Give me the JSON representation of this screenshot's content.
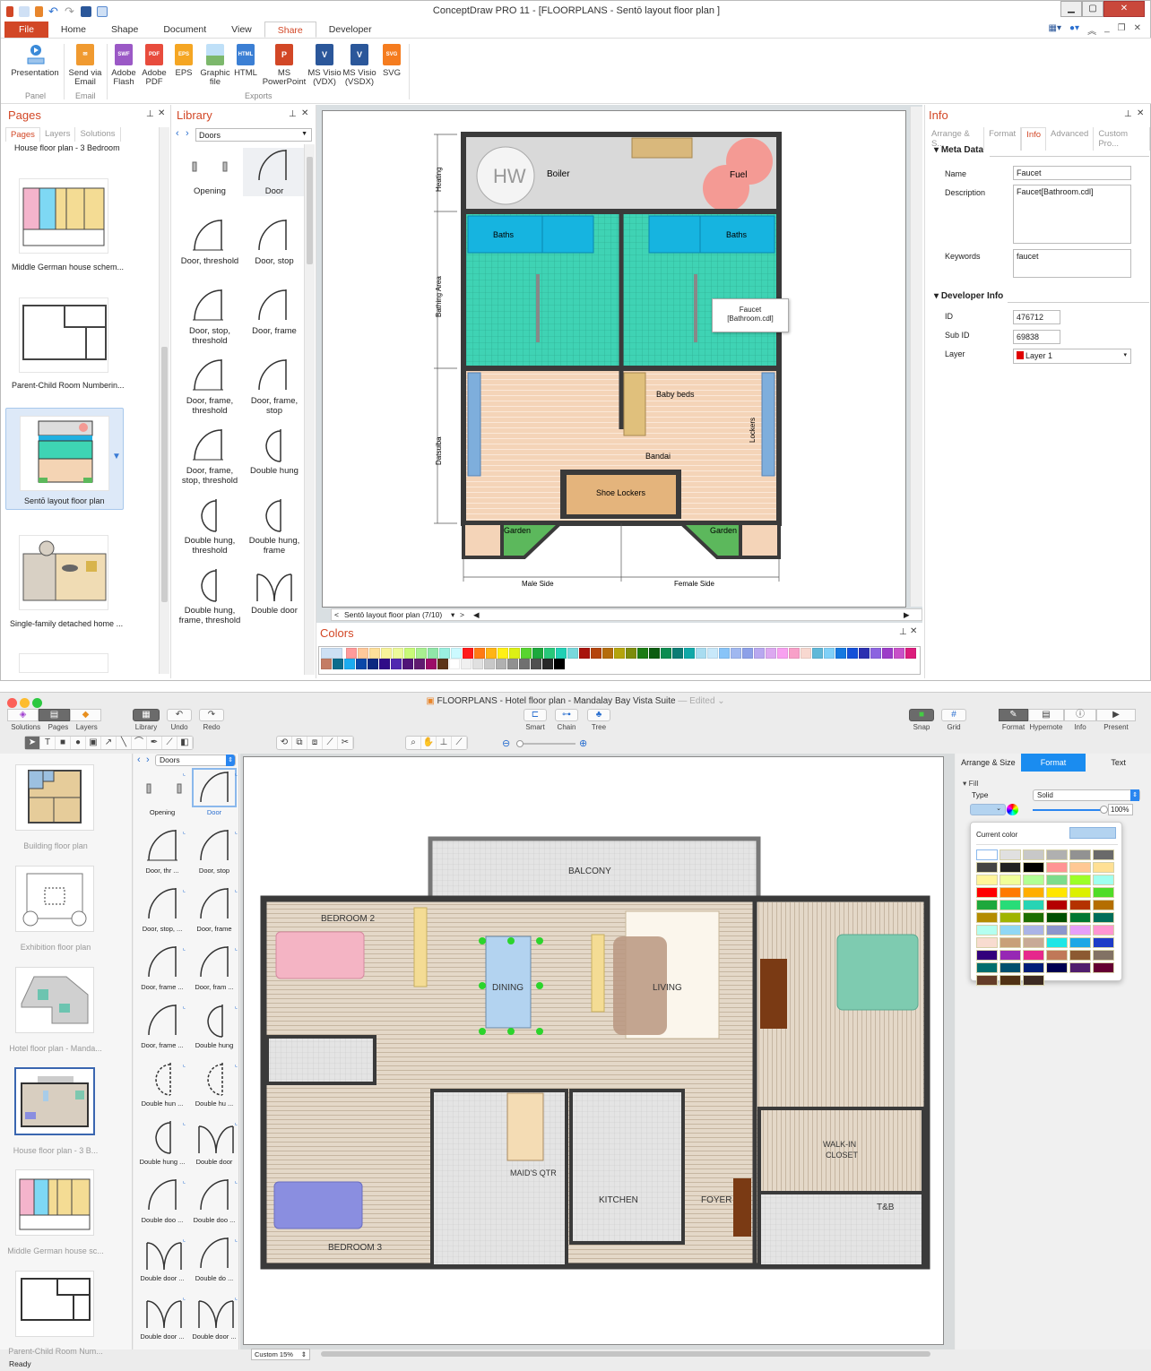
{
  "win": {
    "title": "ConceptDraw PRO 11 - [FLOORPLANS - Sentō layout floor plan ]",
    "ribbon_tabs": [
      {
        "label": "File"
      },
      {
        "label": "Home"
      },
      {
        "label": "Shape"
      },
      {
        "label": "Document"
      },
      {
        "label": "View"
      },
      {
        "label": "Share"
      },
      {
        "label": "Developer"
      }
    ],
    "active_tab": "Share",
    "ribbon_buttons": [
      {
        "label": "Presentation",
        "group": "Panel",
        "icon": "presentation-icon"
      },
      {
        "label": "Send via Email",
        "group": "Email",
        "icon": "email-icon"
      },
      {
        "label": "Adobe Flash",
        "group": "Exports",
        "icon": "swf-file-icon",
        "badge": "SWF",
        "color": "#9b59c6"
      },
      {
        "label": "Adobe PDF",
        "group": "Exports",
        "icon": "pdf-file-icon",
        "badge": "PDF",
        "color": "#e84c3d"
      },
      {
        "label": "EPS",
        "group": "Exports",
        "icon": "eps-file-icon",
        "badge": "EPS",
        "color": "#f5a623"
      },
      {
        "label": "Graphic file",
        "group": "Exports",
        "icon": "image-file-icon",
        "badge": "",
        "color": "#7fb9e6"
      },
      {
        "label": "HTML",
        "group": "Exports",
        "icon": "html-file-icon",
        "badge": "HTML",
        "color": "#3b7fd4"
      },
      {
        "label": "MS PowerPoint",
        "group": "Exports",
        "icon": "powerpoint-icon",
        "badge": "P",
        "color": "#d24726"
      },
      {
        "label": "MS Visio (VDX)",
        "group": "Exports",
        "icon": "visio-vdx-icon",
        "badge": "V",
        "color": "#2b579a"
      },
      {
        "label": "MS Visio (VSDX)",
        "group": "Exports",
        "icon": "visio-vsdx-icon",
        "badge": "V",
        "color": "#2b579a"
      },
      {
        "label": "SVG",
        "group": "Exports",
        "icon": "svg-file-icon",
        "badge": "SVG",
        "color": "#f57c1f"
      }
    ],
    "ribbon_groups": {
      "panel": "Panel",
      "email": "Email",
      "exports": "Exports"
    },
    "pages_panel": {
      "title": "Pages",
      "tabs": [
        "Pages",
        "Layers",
        "Solutions"
      ],
      "items": [
        {
          "label": "House floor plan - 3 Bedroom"
        },
        {
          "label": "Middle German house schem..."
        },
        {
          "label": "Parent-Child Room Numberin..."
        },
        {
          "label": "Sentō layout floor plan",
          "selected": true
        },
        {
          "label": "Single-family detached home ..."
        }
      ]
    },
    "library_panel": {
      "title": "Library",
      "selected_library": "Doors",
      "items": [
        {
          "label": "Opening"
        },
        {
          "label": "Door"
        },
        {
          "label": "Door, threshold"
        },
        {
          "label": "Door, stop"
        },
        {
          "label": "Door, stop, threshold"
        },
        {
          "label": "Door, frame"
        },
        {
          "label": "Door, frame, threshold"
        },
        {
          "label": "Door, frame, stop"
        },
        {
          "label": "Door, frame, stop, threshold"
        },
        {
          "label": "Double hung"
        },
        {
          "label": "Double hung, threshold"
        },
        {
          "label": "Double hung, frame"
        },
        {
          "label": "Double hung, frame, threshold"
        },
        {
          "label": "Double door"
        }
      ]
    },
    "canvas": {
      "page_nav": "Sentō layout floor plan  (7/10)",
      "plan_labels": {
        "boiler": "Boiler",
        "hw": "HW",
        "fuel": "Fuel",
        "baths_left": "Baths",
        "baths_right": "Baths",
        "baby_beds": "Baby beds",
        "bandai": "Bandai",
        "lockers": "Lockers",
        "shoe_lockers": "Shoe Lockers",
        "garden_left": "Garden",
        "garden_right": "Garden",
        "male_side": "Male Side",
        "female_side": "Female Side",
        "heating": "Heating",
        "bathing_area": "Bathing Area",
        "datsuiba": "Datsuiba"
      },
      "tooltip": {
        "line1": "Faucet",
        "line2": "[Bathroom.cdl]"
      }
    },
    "colors_panel": {
      "title": "Colors",
      "swatches": [
        "#ff9a9a",
        "#ffc89a",
        "#ffe09a",
        "#f8f49a",
        "#ecfa9a",
        "#c8fa78",
        "#a8f090",
        "#90e6a8",
        "#9af0e0",
        "#ccfaff",
        "#ff1a1a",
        "#ff7a14",
        "#ffb414",
        "#fff014",
        "#dcf014",
        "#58d430",
        "#1ca83c",
        "#28c87a",
        "#20d0b4",
        "#78d8dc",
        "#a8140c",
        "#b4440c",
        "#b46c0c",
        "#b4a40c",
        "#7c8c0c",
        "#1c7c14",
        "#0c5c10",
        "#0c8c50",
        "#0c7c74",
        "#10a8a8",
        "#a8dcf0",
        "#c8e8fa",
        "#88c4f8",
        "#a0b8f0",
        "#8ca0e8",
        "#b8a8f0",
        "#dca8f0",
        "#f8a0f0",
        "#f8a0c8",
        "#f8d8d0",
        "#60b8d8",
        "#80d0f8",
        "#1478e0",
        "#1450d8",
        "#2c30b0",
        "#8c64e0",
        "#9c3cc8",
        "#c850c8",
        "#dc1c7c",
        "#c47c64",
        "#0c6c8c",
        "#1cacf0",
        "#0c48a8",
        "#0c2880",
        "#300c88",
        "#5028b0",
        "#501478",
        "#601c70",
        "#9c0c68",
        "#5c3418",
        "#ffffff",
        "#f0f0f0",
        "#e0e0e0",
        "#c8c8c8",
        "#b0b0b0",
        "#909090",
        "#707070",
        "#505050",
        "#282828",
        "#000000"
      ]
    },
    "info_panel": {
      "title": "Info",
      "tabs": [
        "Arrange & S...",
        "Format",
        "Info",
        "Advanced",
        "Custom Pro..."
      ],
      "active_tab": "Info",
      "meta_section": "Meta Data",
      "name_label": "Name",
      "name_value": "Faucet",
      "description_label": "Description",
      "description_value": "Faucet[Bathroom.cdl]",
      "keywords_label": "Keywords",
      "keywords_value": "faucet",
      "dev_section": "Developer Info",
      "id_label": "ID",
      "id_value": "476712",
      "subid_label": "Sub ID",
      "subid_value": "69838",
      "layer_label": "Layer",
      "layer_value": "Layer 1",
      "layer_color": "#e00000"
    }
  },
  "mac": {
    "title": "FLOORPLANS - Hotel floor plan - Mandalay Bay Vista Suite",
    "edited": "— Edited ⌄",
    "toolbar": {
      "solutions": "Solutions",
      "pages": "Pages",
      "layers": "Layers",
      "library": "Library",
      "undo": "Undo",
      "redo": "Redo",
      "smart": "Smart",
      "chain": "Chain",
      "tree": "Tree",
      "snap": "Snap",
      "grid": "Grid",
      "format": "Format",
      "hypernote": "Hypernote",
      "info": "Info",
      "present": "Present"
    },
    "pages": [
      {
        "label": "Building floor plan"
      },
      {
        "label": "Exhibition floor plan"
      },
      {
        "label": "Hotel floor plan - Manda..."
      },
      {
        "label": "House floor plan - 3 B...",
        "selected": true
      },
      {
        "label": "Middle German house sc..."
      },
      {
        "label": "Parent-Child Room Num..."
      }
    ],
    "library": {
      "selected_library": "Doors",
      "items": [
        {
          "label": "Opening"
        },
        {
          "label": "Door",
          "selected": true
        },
        {
          "label": "Door, thr ..."
        },
        {
          "label": "Door, stop"
        },
        {
          "label": "Door, stop, ..."
        },
        {
          "label": "Door, frame"
        },
        {
          "label": "Door, frame ..."
        },
        {
          "label": "Door, fram ..."
        },
        {
          "label": "Door, frame ..."
        },
        {
          "label": "Double hung"
        },
        {
          "label": "Double hun ..."
        },
        {
          "label": "Double hu ..."
        },
        {
          "label": "Double hung ..."
        },
        {
          "label": "Double door"
        },
        {
          "label": "Double doo ..."
        },
        {
          "label": "Double doo ..."
        },
        {
          "label": "Double door ..."
        },
        {
          "label": "Double do ..."
        },
        {
          "label": "Double door ..."
        },
        {
          "label": "Double door ..."
        }
      ]
    },
    "canvas": {
      "zoom": "Custom 15%",
      "rooms": {
        "balcony": "BALCONY",
        "bedroom2": "BEDROOM 2",
        "dining": "DINING",
        "living": "LIVING",
        "walkin": "WALK-IN",
        "closet": "CLOSET",
        "maids": "MAID'S QTR",
        "kitchen": "KITCHEN",
        "foyer": "FOYER",
        "tb": "T&B",
        "bedroom3": "BEDROOM 3"
      }
    },
    "inspector": {
      "tabs": [
        "Arrange & Size",
        "Format",
        "Text"
      ],
      "active_tab": "Format",
      "fill_section": "Fill",
      "type_label": "Type",
      "type_value": "Solid",
      "opacity": "100%",
      "opacity_fraction": 1.0,
      "current_color_label": "Current color",
      "current_color": "#b3d3f0",
      "palette": [
        "#ffffff",
        "#e0e0e0",
        "#c8c8c8",
        "#b0b0b0",
        "#929292",
        "#6a6a6a",
        "#444444",
        "#222222",
        "#000000",
        "#ff9494",
        "#ffc894",
        "#ffe094",
        "#fff59a",
        "#f0ff9a",
        "#b0ff94",
        "#7cdc8c",
        "#9cff28",
        "#a0fff0",
        "#ff0000",
        "#ff7a00",
        "#ffae00",
        "#ffe600",
        "#dcf000",
        "#50dc28",
        "#1ea83c",
        "#28dc78",
        "#28d4b4",
        "#b40000",
        "#b43200",
        "#b46e00",
        "#b48c00",
        "#a0b400",
        "#1e6e00",
        "#005000",
        "#007832",
        "#006e5a",
        "#b4fff0",
        "#90d8f4",
        "#aab4e6",
        "#8c96cc",
        "#e6a0f8",
        "#ff96d2",
        "#f8dcd0",
        "#c8a078",
        "#c8aa96",
        "#1ee6e6",
        "#1ea8e6",
        "#1e3cc8",
        "#32007c",
        "#9628b4",
        "#e6288c",
        "#c07858",
        "#8c5a32",
        "#827264",
        "#006e6e",
        "#00506e",
        "#001e78",
        "#000050",
        "#501e6e",
        "#640032",
        "#643c28",
        "#503214",
        "#3c2a22"
      ],
      "status": "Ready"
    }
  }
}
